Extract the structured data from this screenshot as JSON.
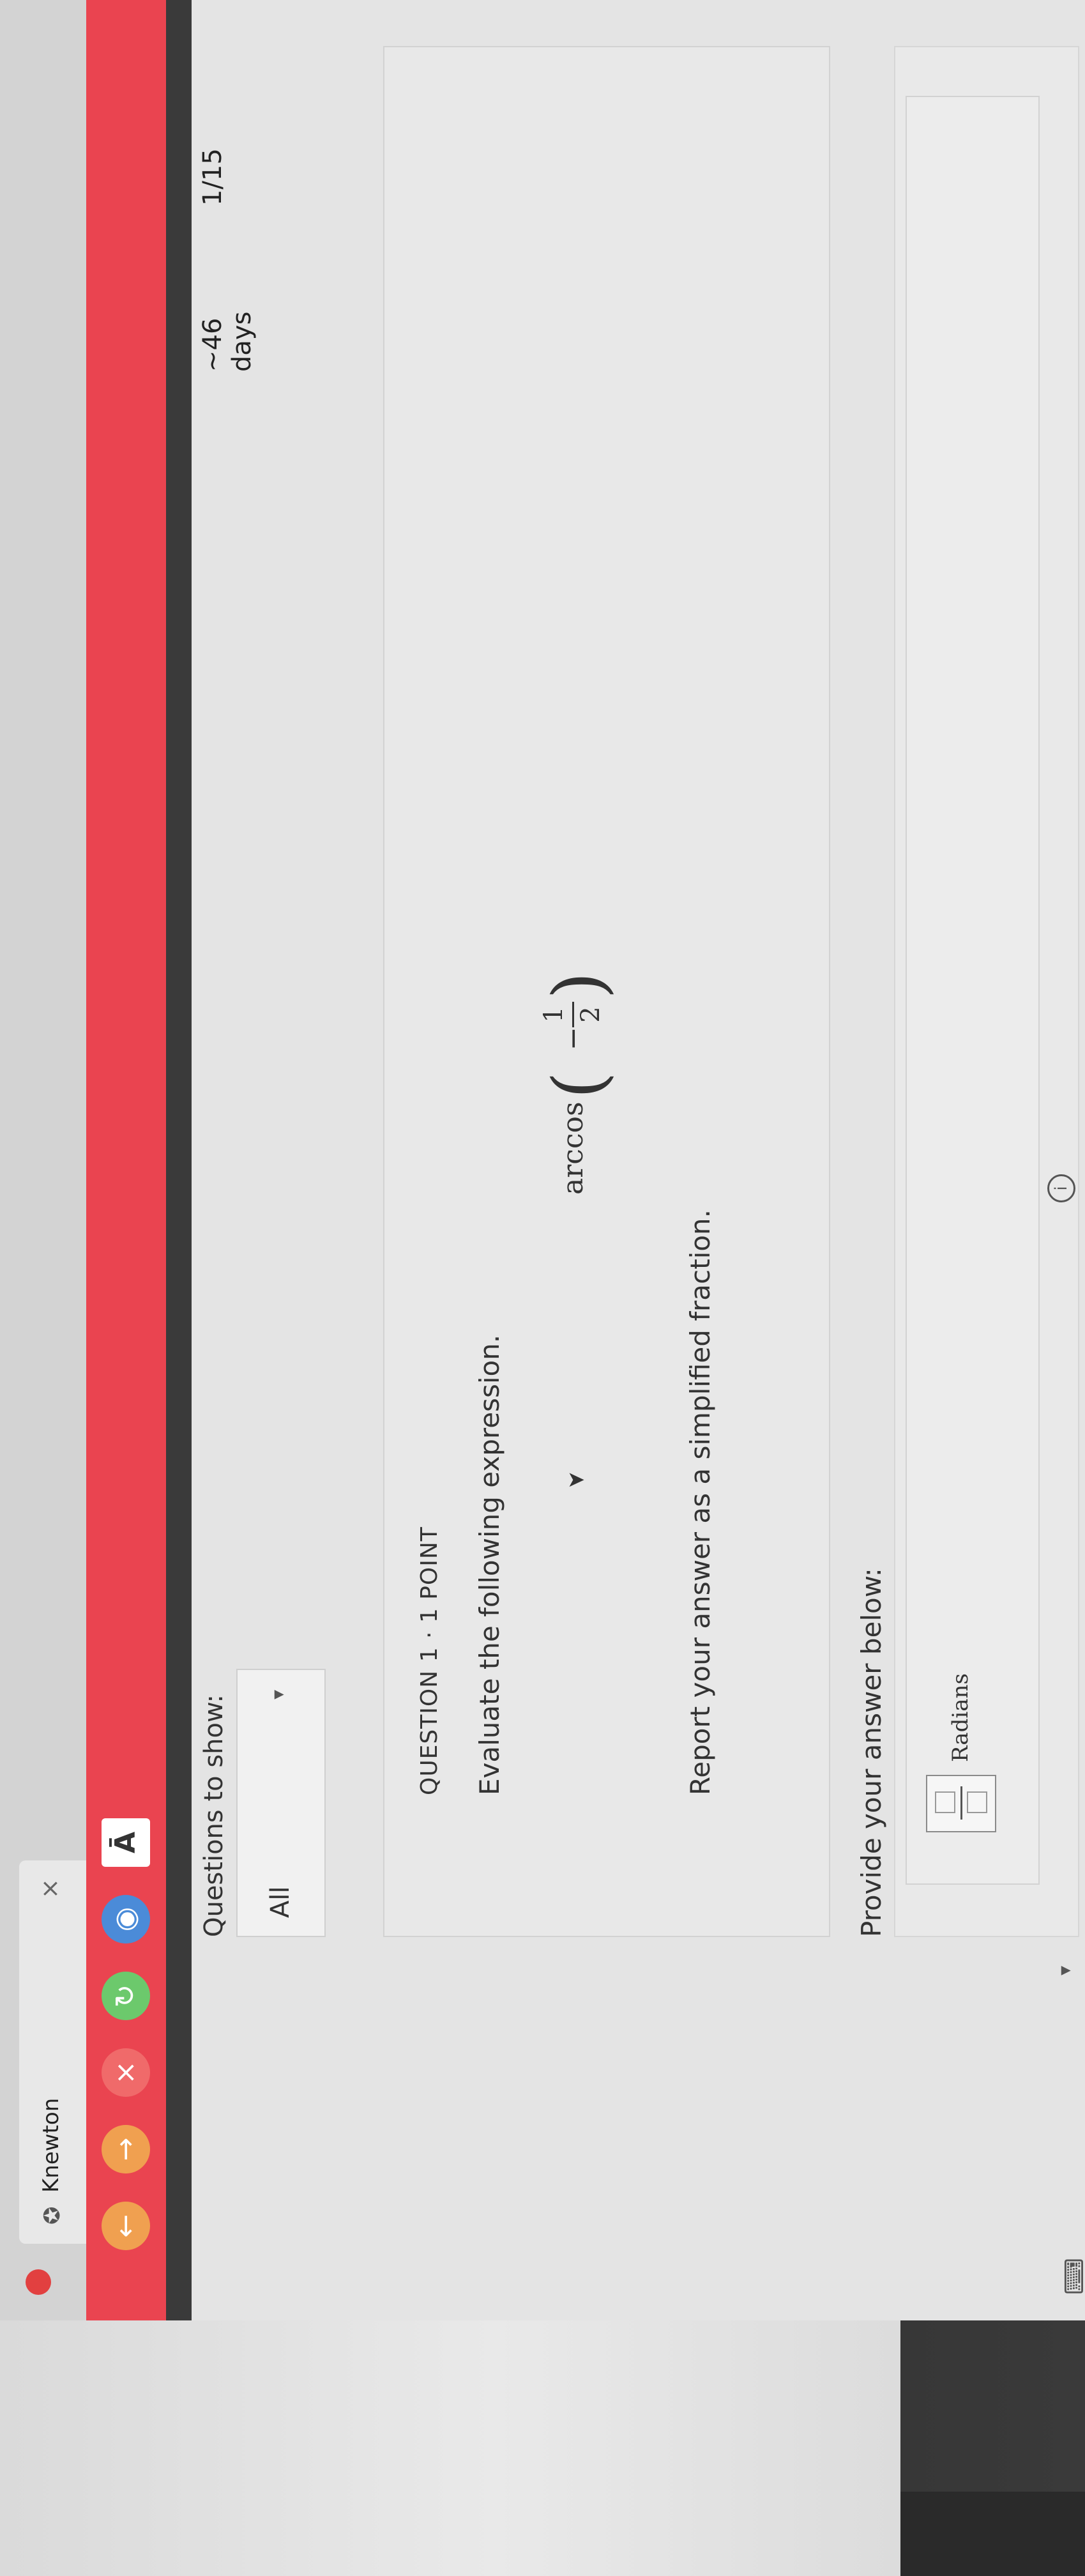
{
  "browser": {
    "tab_title": "Knewton",
    "tab_close": "×",
    "toolbar": {
      "back": "←",
      "forward": "→",
      "stop": "×",
      "reload": "↻",
      "globe": "◉",
      "font": "Ā"
    }
  },
  "header": {
    "days_left": "~46 days",
    "question_count": "1/15"
  },
  "filter": {
    "label": "Questions to show:",
    "value": "All",
    "caret": "▾"
  },
  "question": {
    "header": "QUESTION 1 · 1 POINT",
    "prompt": "Evaluate the following expression.",
    "expression": {
      "function": "arccos",
      "sign": "−",
      "numerator": "1",
      "denominator": "2"
    },
    "instruction": "Report your answer as a simplified fraction."
  },
  "answer": {
    "label": "Provide your answer below:",
    "units": "Radians"
  },
  "footer": {
    "keyboard": "⌨",
    "caret": "▾",
    "info": "i",
    "next": "›"
  },
  "colors": {
    "toolbar": "#ea4450",
    "tab_strip": "#d3d3d3",
    "content_bg": "#e4e4e4"
  }
}
